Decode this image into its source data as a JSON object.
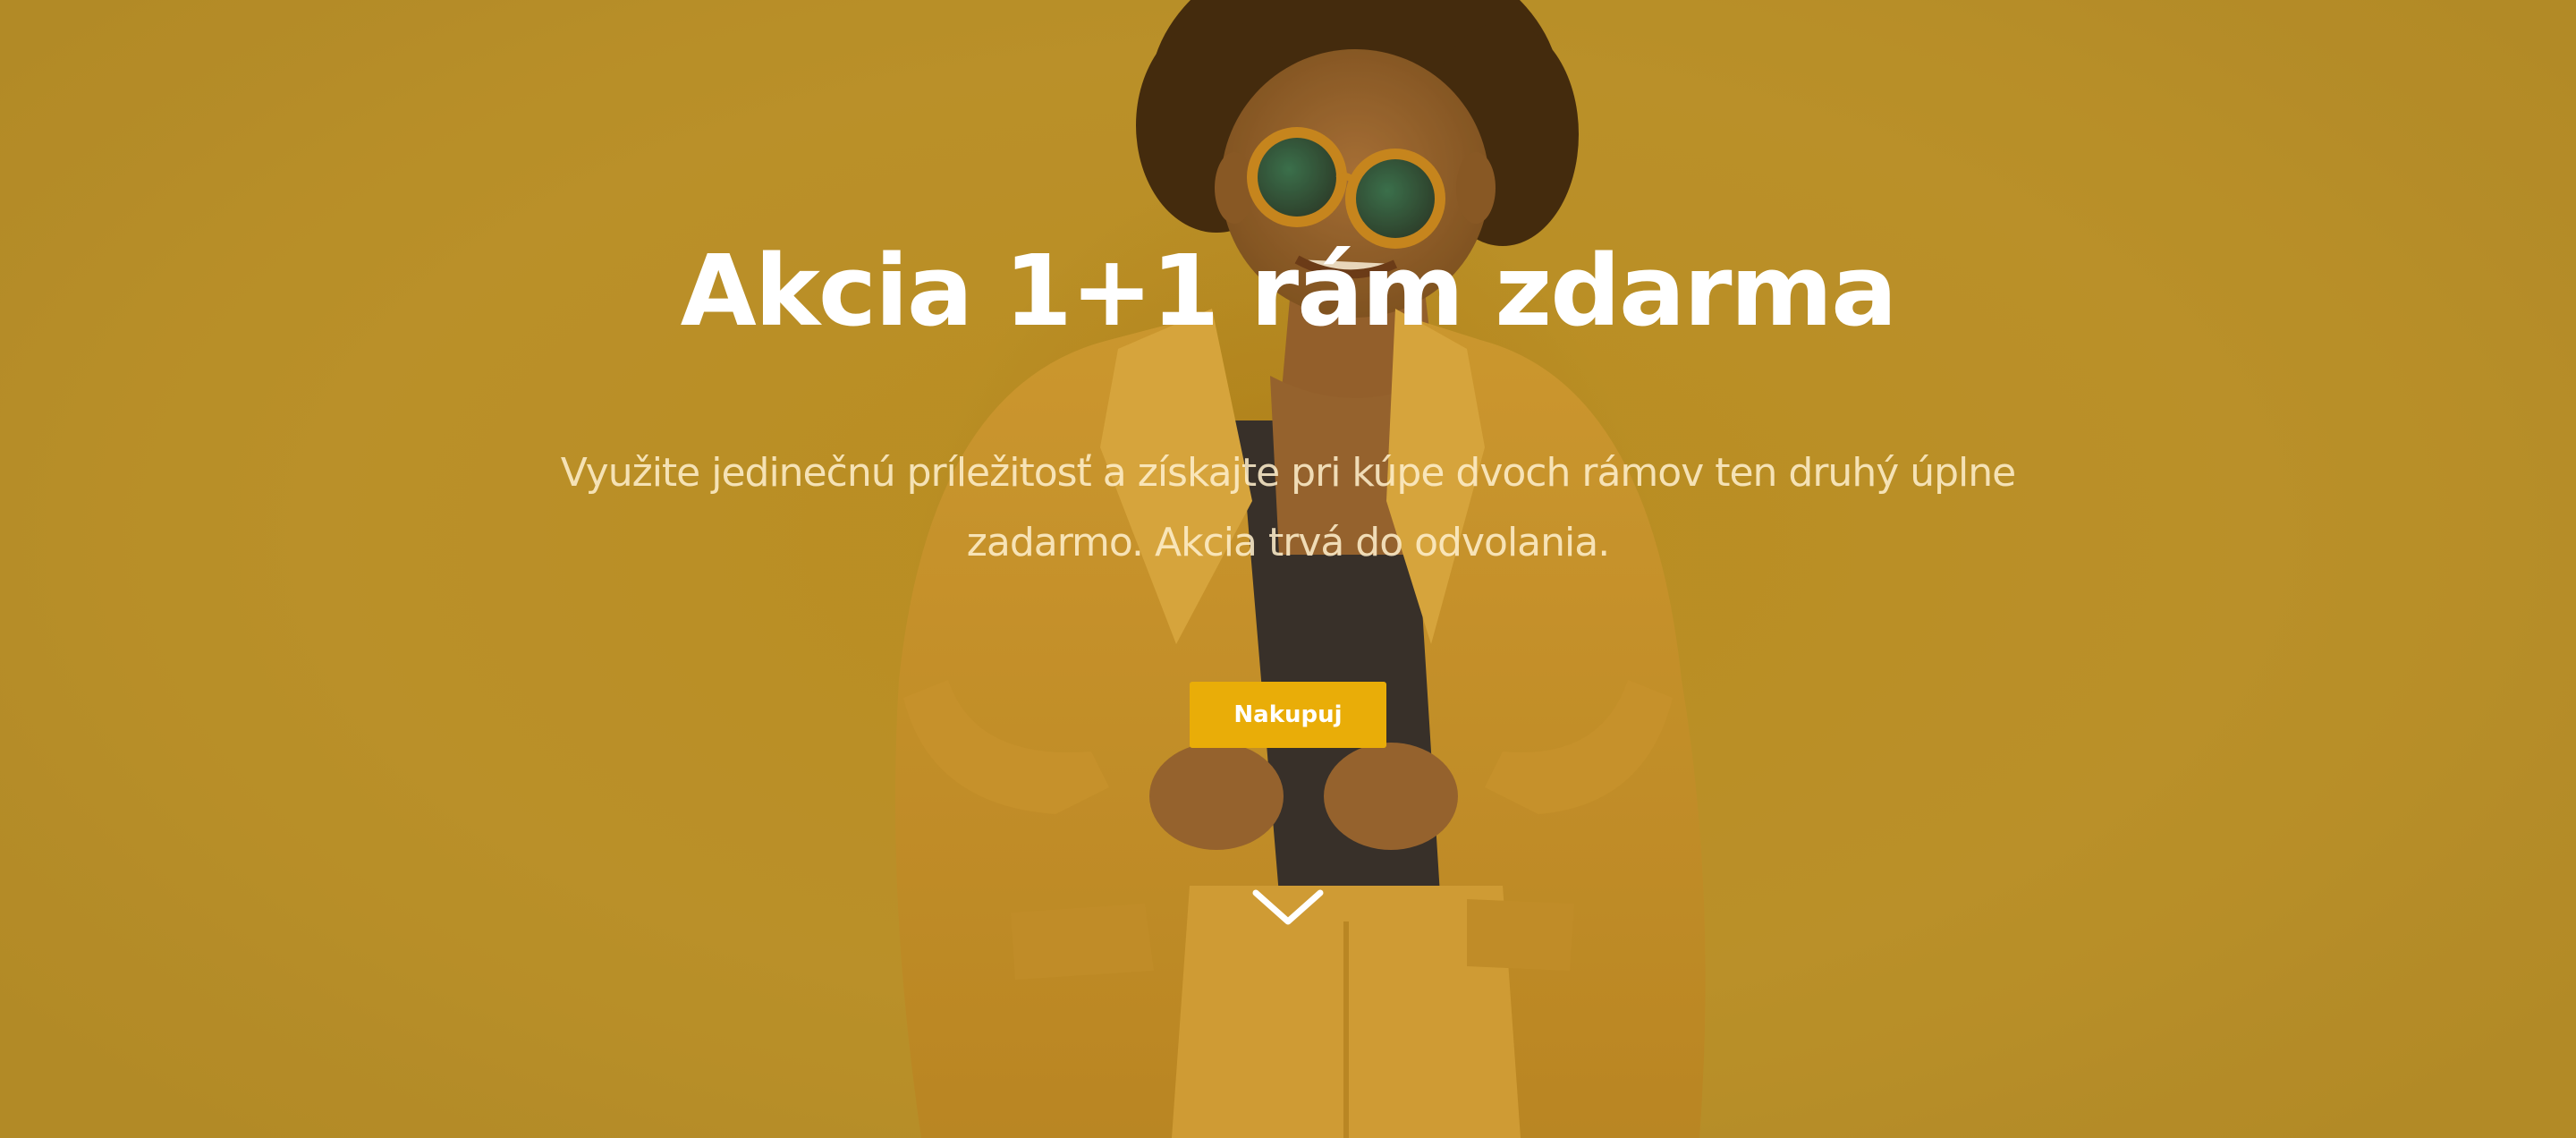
{
  "hero": {
    "title": "Akcia 1+1 rám zdarma",
    "subtitle": "Využite jedinečnú príležitosť a získajte pri kúpe dvoch rámov ten druhý úplne zadarmo. Akcia trvá do odvolania.",
    "cta_label": "Nakupuj",
    "scroll_icon": "chevron-down-icon"
  },
  "colors": {
    "background": "#b98d23",
    "button": "#e9ad08",
    "title_text": "#ffffff"
  }
}
